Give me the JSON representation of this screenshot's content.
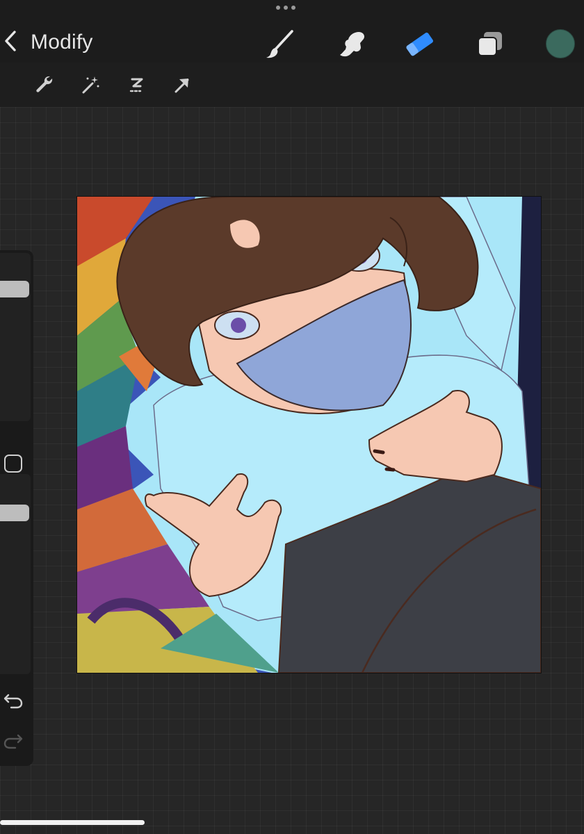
{
  "header": {
    "back_label": "Modify",
    "tools": [
      "brush-icon",
      "smudge-icon",
      "eraser-icon",
      "layers-icon"
    ],
    "active_tool": "eraser",
    "current_color": "#3b6a5e"
  },
  "subtoolbar": {
    "tools": [
      "wrench-icon",
      "magic-wand-icon",
      "selection-icon",
      "transform-arrow-icon"
    ]
  },
  "sidebar": {
    "controls": [
      "brush-size-slider",
      "modify-button",
      "opacity-slider",
      "undo-icon",
      "redo-icon"
    ]
  },
  "colors": {
    "accent": "#2f8cff",
    "canvas_bg": "#a9e6f8",
    "hair": "#5b3a2a",
    "mask": "#8fa6d8",
    "pants": "#3d3f46"
  }
}
